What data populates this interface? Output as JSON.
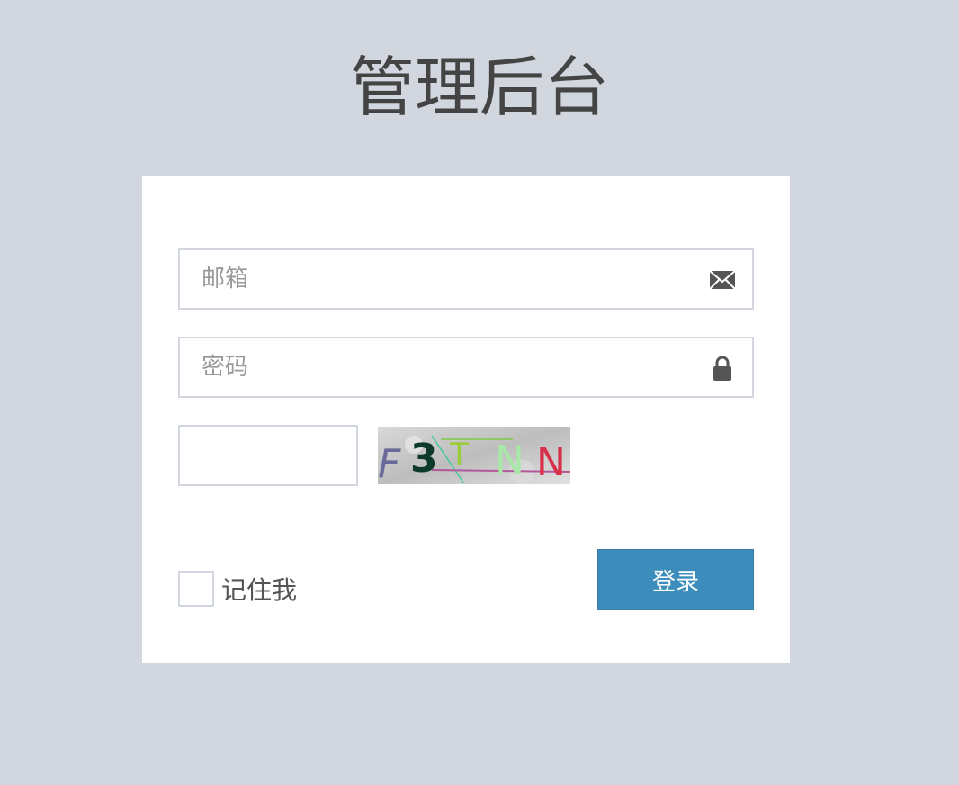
{
  "page": {
    "title": "管理后台"
  },
  "login_form": {
    "email_placeholder": "邮箱",
    "email_value": "",
    "email_icon": "envelope-icon",
    "password_placeholder": "密码",
    "password_value": "",
    "password_icon": "lock-icon",
    "captcha_value": "",
    "captcha_text": "F3TNN",
    "remember_label": "记住我",
    "remember_checked": false,
    "login_label": "登录"
  },
  "colors": {
    "background": "#d2d6de",
    "card": "#ffffff",
    "primary_button": "#3c8dbc",
    "border": "#d2d6de"
  }
}
